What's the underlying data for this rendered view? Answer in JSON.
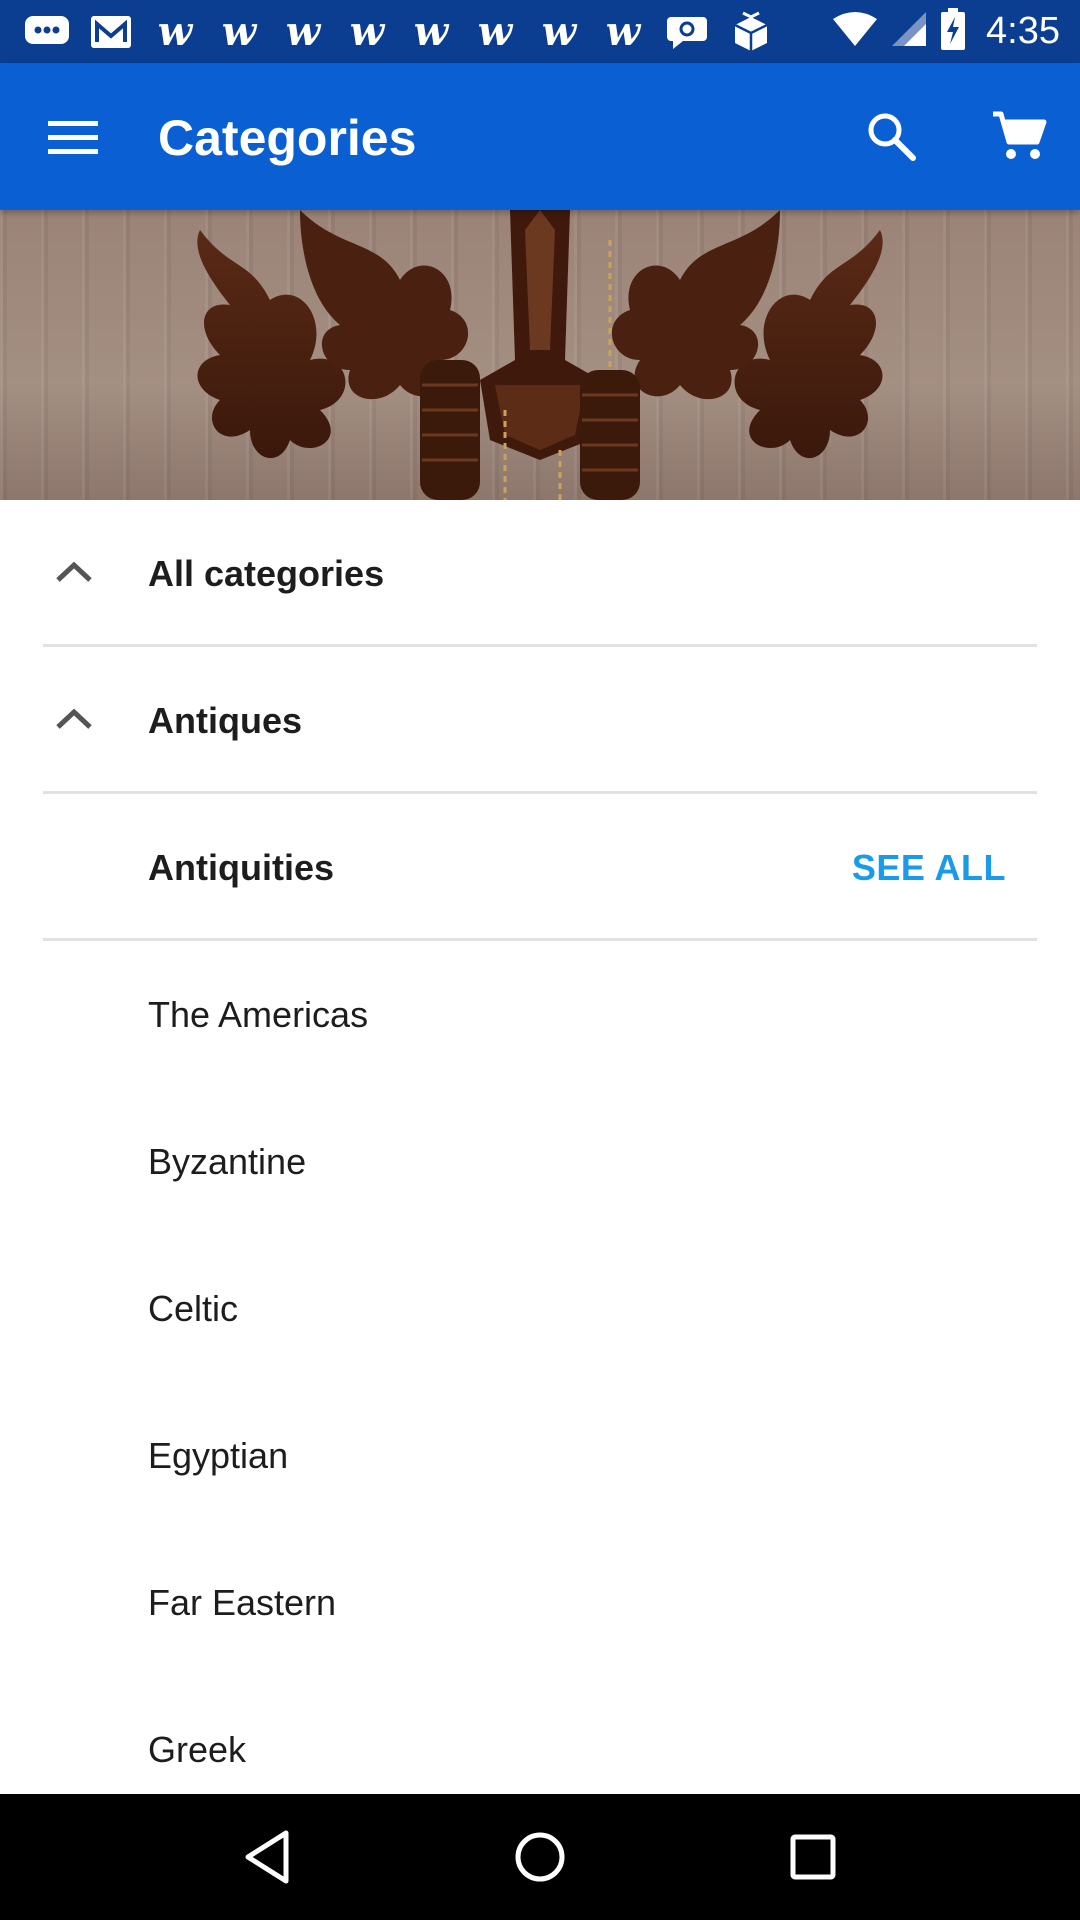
{
  "status_bar": {
    "time": "4:35",
    "notification_icons": [
      "chat-bubble-icon",
      "mail-icon",
      "w-app-icon",
      "w-app-icon",
      "w-app-icon",
      "w-app-icon",
      "w-app-icon",
      "w-app-icon",
      "w-app-icon",
      "w-app-icon",
      "speech-bubble-icon",
      "box-icon"
    ],
    "w_glyph": "w",
    "colors": {
      "background": "#0b3d91"
    }
  },
  "app_bar": {
    "title": "Categories",
    "icons": [
      "menu-icon",
      "search-icon",
      "cart-icon"
    ],
    "colors": {
      "background": "#0a5fd3"
    }
  },
  "hero": {
    "image": "cuckoo-clock-photo"
  },
  "list": {
    "expanded_rows": [
      {
        "label": "All categories",
        "icon": "chevron-up-icon"
      },
      {
        "label": "Antiques",
        "icon": "chevron-up-icon"
      }
    ],
    "section": {
      "label": "Antiquities",
      "action": "SEE ALL",
      "action_color": "#1a9be8"
    },
    "subcategories": [
      "The Americas",
      "Byzantine",
      "Celtic",
      "Egyptian",
      "Far Eastern",
      "Greek"
    ]
  },
  "nav_bar": {
    "icons": [
      "back-icon",
      "home-icon",
      "recents-icon"
    ]
  }
}
